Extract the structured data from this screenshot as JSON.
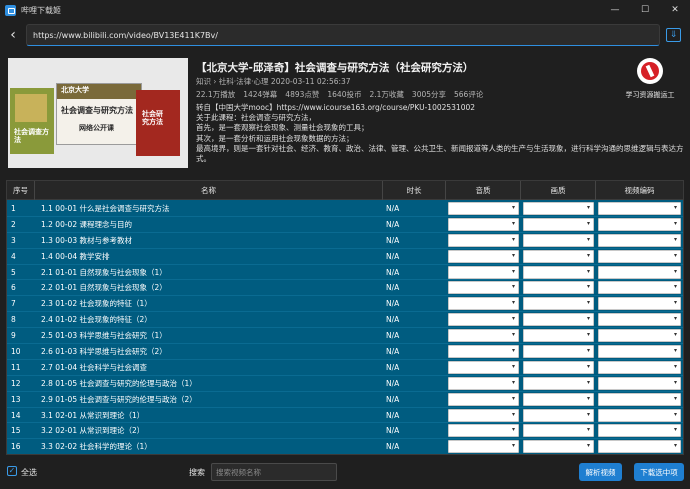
{
  "window": {
    "title": "哔哩下载姬",
    "minimize": "—",
    "maximize": "☐",
    "close": "✕"
  },
  "urlbar": {
    "back": "‹",
    "url": "https://www.bilibili.com/video/BV13E411K7Bv/",
    "download": "⇓"
  },
  "cover": {
    "book1": "社会调查方法",
    "book2_head": "北京大学",
    "book2_title": "社会调查与研究方法",
    "book2_sub": "网络公开课",
    "book3": "社会研究方法"
  },
  "video": {
    "title": "【北京大学-邱泽奇】社会调查与研究方法（社会研究方法）",
    "meta": "知识 › 社科·法律·心理   2020-03-11 02:56:37",
    "stats": [
      "22.1万播放",
      "1424弹幕",
      "4893点赞",
      "1640投币",
      "2.1万收藏",
      "3005分享",
      "566评论"
    ],
    "desc": [
      "转自【中国大学mooc】https://www.icourse163.org/course/PKU-1002531002",
      "关于此课程：社会调查与研究方法，",
      "首先，是一套观察社会现象、测量社会现象的工具；",
      "其次，是一套分析和运用社会现象数据的方法；",
      "最高境界，则是一套针对社会、经济、教育、政治、法律、管理、公共卫生、新闻报道等人类的生产与生活现象，进行科学沟通的思维逻辑与表达方式。"
    ]
  },
  "uploader": {
    "name": "学习资源搬运工"
  },
  "table": {
    "headers": {
      "no": "序号",
      "name": "名称",
      "duration": "时长",
      "audio_quality": "音质",
      "video_quality": "画质",
      "video_codec": "视频编码"
    },
    "rows": [
      {
        "no": "1",
        "name": "1.1 00-01 什么是社会调查与研究方法",
        "duration": "N/A"
      },
      {
        "no": "2",
        "name": "1.2 00-02 课程理念与目的",
        "duration": "N/A"
      },
      {
        "no": "3",
        "name": "1.3 00-03 教材与参考教材",
        "duration": "N/A"
      },
      {
        "no": "4",
        "name": "1.4 00-04 教学安排",
        "duration": "N/A"
      },
      {
        "no": "5",
        "name": "2.1 01-01 自然现象与社会现象（1）",
        "duration": "N/A"
      },
      {
        "no": "6",
        "name": "2.2 01-01 自然现象与社会现象（2）",
        "duration": "N/A"
      },
      {
        "no": "7",
        "name": "2.3 01-02 社会现象的特征（1）",
        "duration": "N/A"
      },
      {
        "no": "8",
        "name": "2.4 01-02 社会现象的特征（2）",
        "duration": "N/A"
      },
      {
        "no": "9",
        "name": "2.5 01-03 科学思维与社会研究（1）",
        "duration": "N/A"
      },
      {
        "no": "10",
        "name": "2.6 01-03 科学思维与社会研究（2）",
        "duration": "N/A"
      },
      {
        "no": "11",
        "name": "2.7 01-04 社会科学与社会调查",
        "duration": "N/A"
      },
      {
        "no": "12",
        "name": "2.8 01-05 社会调查与研究的伦理与政治（1）",
        "duration": "N/A"
      },
      {
        "no": "13",
        "name": "2.9 01-05 社会调查与研究的伦理与政治（2）",
        "duration": "N/A"
      },
      {
        "no": "14",
        "name": "3.1 02-01 从常识到理论（1）",
        "duration": "N/A"
      },
      {
        "no": "15",
        "name": "3.2 02-01 从常识到理论（2）",
        "duration": "N/A"
      },
      {
        "no": "16",
        "name": "3.3 02-02 社会科学的理论（1）",
        "duration": "N/A"
      }
    ]
  },
  "bottom": {
    "select_all_check": "✓",
    "select_all": "全选",
    "search_label": "搜索",
    "search_placeholder": "搜索视频名称",
    "parse_button": "解析视频",
    "download_button": "下载选中项"
  }
}
